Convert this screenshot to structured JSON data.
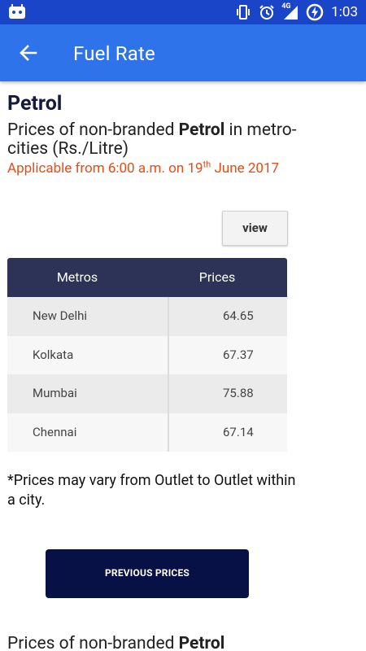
{
  "status_bar": {
    "time": "1:03",
    "network": "4G",
    "icons": [
      "notification-app-icon",
      "vibrate-icon",
      "alarm-icon",
      "signal-icon",
      "battery-charging-icon"
    ]
  },
  "app_bar": {
    "title": "Fuel Rate",
    "back_icon": "arrow-back-icon"
  },
  "section": {
    "title": "Petrol",
    "subtitle_pre": "Prices of non-branded ",
    "subtitle_bold": "Petrol",
    "subtitle_post": " in metro-cities (Rs./Litre)",
    "applicable_pre": "Applicable from 6:00 a.m. on 19",
    "applicable_sup": "th",
    "applicable_post": " June 2017"
  },
  "view_button": "view",
  "table": {
    "headers": [
      "Metros",
      "Prices"
    ],
    "rows": [
      {
        "metro": "New Delhi",
        "price": "64.65"
      },
      {
        "metro": "Kolkata",
        "price": "67.37"
      },
      {
        "metro": "Mumbai",
        "price": "75.88"
      },
      {
        "metro": "Chennai",
        "price": "67.14"
      }
    ]
  },
  "note": "*Prices may vary from Outlet to Outlet within a city.",
  "previous_button": "PREVIOUS PRICES",
  "next_section": {
    "subtitle_pre": "Prices of non-branded ",
    "subtitle_bold": "Petrol"
  },
  "colors": {
    "status_bar": "#1b45c9",
    "app_bar": "#2f73ea",
    "table_header": "#2c3356",
    "applicable_text": "#ea4b14",
    "previous_button": "#071146"
  }
}
